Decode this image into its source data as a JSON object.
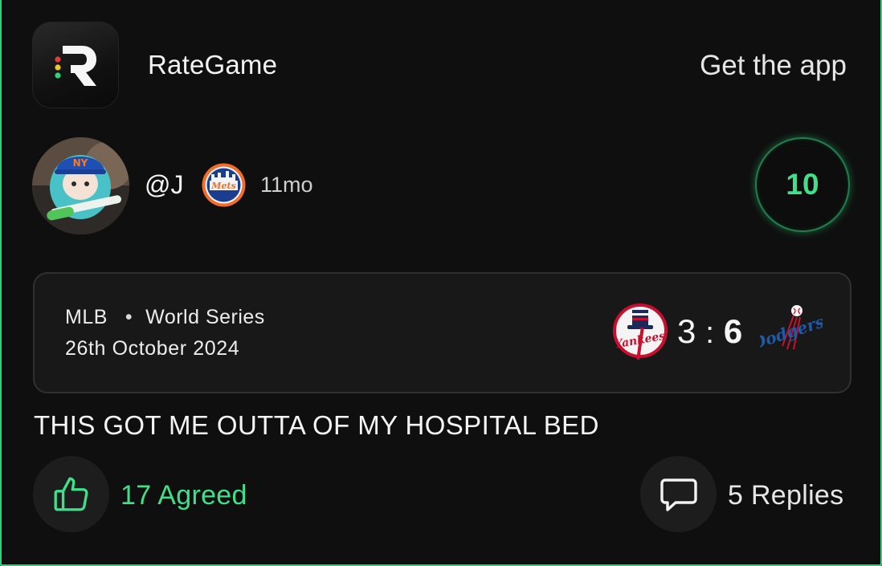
{
  "header": {
    "app_name": "RateGame",
    "get_app_label": "Get the app",
    "logo_icon": "rategame-logo-icon"
  },
  "post": {
    "username": "@J",
    "team_badge_icon": "mets-logo-icon",
    "time_ago": "11mo",
    "rating": "10",
    "review_text": "THIS GOT ME OUTTA OF MY HOSPITAL BED"
  },
  "game": {
    "league": "MLB",
    "separator": "•",
    "event": "World Series",
    "date": "26th October 2024",
    "home_team_icon": "yankees-logo-icon",
    "away_team_icon": "dodgers-logo-icon",
    "home_score": "3",
    "score_separator": ":",
    "away_score": "6"
  },
  "actions": {
    "agree_label": "17 Agreed",
    "reply_label": "5 Replies"
  },
  "colors": {
    "accent": "#3ee08a",
    "background": "#0f0f0f",
    "card": "#181818"
  }
}
